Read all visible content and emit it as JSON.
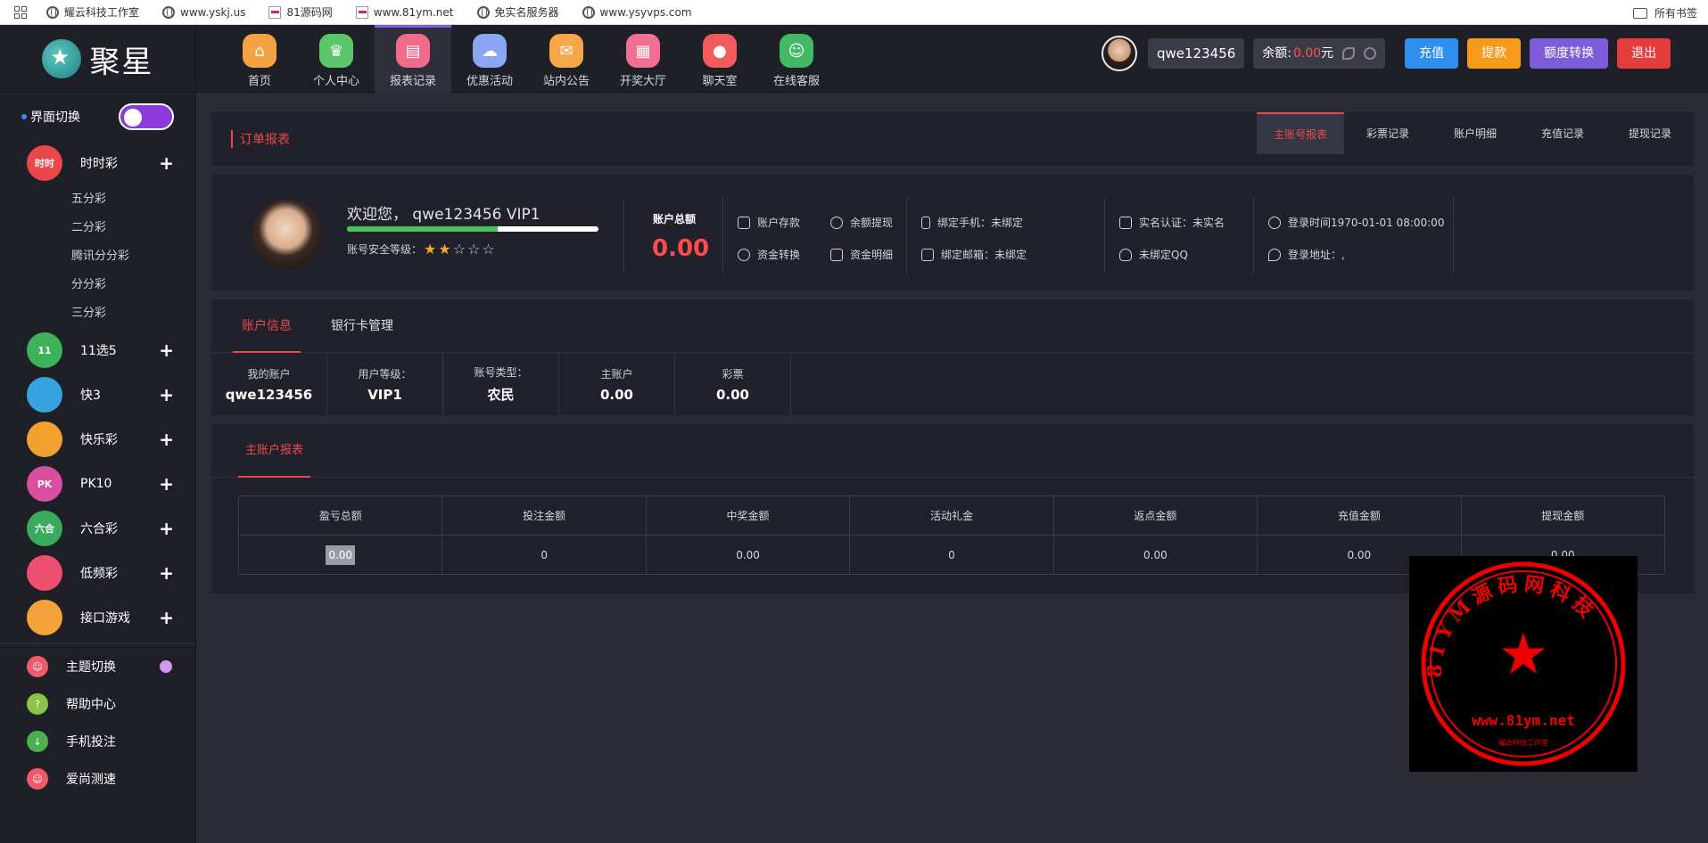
{
  "bookmarks": {
    "items": [
      "耀云科技工作室",
      "www.yskj.us",
      "81源码网",
      "www.81ym.net",
      "免实名服务器",
      "www.ysyvps.com"
    ],
    "right": "所有书签"
  },
  "brand": {
    "logo_text": "聚星"
  },
  "nav": {
    "items": [
      {
        "label": "首页",
        "color": "#f5a340",
        "icon": "home-icon"
      },
      {
        "label": "个人中心",
        "color": "#5cc66a",
        "icon": "crown-icon"
      },
      {
        "label": "报表记录",
        "color": "#f06a8a",
        "icon": "report-icon"
      },
      {
        "label": "优惠活动",
        "color": "#8aa6f4",
        "icon": "gift-icon"
      },
      {
        "label": "站内公告",
        "color": "#f7a64a",
        "icon": "mail-icon"
      },
      {
        "label": "开奖大厅",
        "color": "#f16f93",
        "icon": "grid-icon"
      },
      {
        "label": "聊天室",
        "color": "#f25b5b",
        "icon": "chat-icon"
      },
      {
        "label": "在线客服",
        "color": "#43b867",
        "icon": "support-icon"
      }
    ],
    "active_index": 2
  },
  "header": {
    "username": "qwe123456",
    "balance_label": "余额:",
    "balance_value": "0.00",
    "balance_unit": "元",
    "buttons": [
      {
        "label": "充值",
        "color": "#2f8ff0"
      },
      {
        "label": "提款",
        "color": "#f59a19"
      },
      {
        "label": "额度转换",
        "color": "#7c5cd8"
      },
      {
        "label": "退出",
        "color": "#e63c3c"
      }
    ]
  },
  "sidebar": {
    "switch_label": "界面切换",
    "categories": [
      {
        "label": "时时彩",
        "color": "#e8484b",
        "icon_text": "时时"
      },
      {
        "label": "11选5",
        "color": "#3cb25a",
        "icon_text": "11"
      },
      {
        "label": "快3",
        "color": "#34a3e0",
        "icon_text": ""
      },
      {
        "label": "快乐彩",
        "color": "#f2a12f",
        "icon_text": ""
      },
      {
        "label": "PK10",
        "color": "#d84f9f",
        "icon_text": "PK"
      },
      {
        "label": "六合彩",
        "color": "#3aaa5c",
        "icon_text": "六合"
      },
      {
        "label": "低频彩",
        "color": "#ee4f6f",
        "icon_text": ""
      },
      {
        "label": "接口游戏",
        "color": "#f4a23a",
        "icon_text": ""
      }
    ],
    "sub_items": [
      "五分彩",
      "二分彩",
      "腾讯分分彩",
      "分分彩",
      "三分彩"
    ],
    "misc": [
      {
        "label": "主题切换",
        "color": "#ef5a6a"
      },
      {
        "label": "帮助中心",
        "color": "#8bc34a"
      },
      {
        "label": "手机投注",
        "color": "#4caf50"
      },
      {
        "label": "爱尚测速",
        "color": "#ef5a6a"
      }
    ]
  },
  "report_tabs": {
    "title": "订单报表",
    "tabs": [
      "主账号报表",
      "彩票记录",
      "账户明细",
      "充值记录",
      "提现记录"
    ]
  },
  "profile": {
    "welcome": "欢迎您，  qwe123456 VIP1",
    "security_label": "账号安全等级：",
    "security_stars": 2,
    "security_max": 5,
    "progress_fraction": 0.6,
    "total_label": "账户总额",
    "total_value": "0.00",
    "actions": [
      "账户存款",
      "余额提现",
      "资金转换",
      "资金明细"
    ],
    "phone": "绑定手机：未绑定",
    "email": "绑定邮箱：未绑定",
    "realname": "实名认证：未实名",
    "qq": "未绑定QQ",
    "login_time": "登录时间1970-01-01 08:00:00",
    "login_addr": "登录地址：,"
  },
  "account": {
    "tabs": [
      "账户信息",
      "银行卡管理"
    ],
    "cells": [
      {
        "k": "我的账户",
        "v": "qwe123456"
      },
      {
        "k": "用户等级：",
        "v": "VIP1"
      },
      {
        "k": "账号类型：",
        "v": "农民"
      },
      {
        "k": "主账户",
        "v": "0.00"
      },
      {
        "k": "彩票",
        "v": "0.00"
      }
    ]
  },
  "report": {
    "tab": "主账户报表",
    "headers": [
      "盈亏总额",
      "投注金额",
      "中奖金额",
      "活动礼金",
      "返点金额",
      "充值金额",
      "提现金额"
    ],
    "row": [
      "0.00",
      "0",
      "0.00",
      "0",
      "0.00",
      "0.00",
      "0.00"
    ]
  },
  "watermark": {
    "text": "81YM源码网科技",
    "url": "www.81ym.net",
    "small": "耀云科技工作室"
  }
}
